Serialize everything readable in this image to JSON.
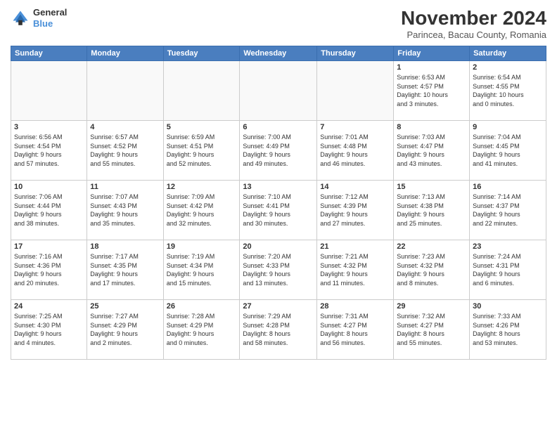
{
  "header": {
    "logo_general": "General",
    "logo_blue": "Blue",
    "month_title": "November 2024",
    "subtitle": "Parincea, Bacau County, Romania"
  },
  "days_of_week": [
    "Sunday",
    "Monday",
    "Tuesday",
    "Wednesday",
    "Thursday",
    "Friday",
    "Saturday"
  ],
  "weeks": [
    [
      {
        "day": "",
        "info": ""
      },
      {
        "day": "",
        "info": ""
      },
      {
        "day": "",
        "info": ""
      },
      {
        "day": "",
        "info": ""
      },
      {
        "day": "",
        "info": ""
      },
      {
        "day": "1",
        "info": "Sunrise: 6:53 AM\nSunset: 4:57 PM\nDaylight: 10 hours\nand 3 minutes."
      },
      {
        "day": "2",
        "info": "Sunrise: 6:54 AM\nSunset: 4:55 PM\nDaylight: 10 hours\nand 0 minutes."
      }
    ],
    [
      {
        "day": "3",
        "info": "Sunrise: 6:56 AM\nSunset: 4:54 PM\nDaylight: 9 hours\nand 57 minutes."
      },
      {
        "day": "4",
        "info": "Sunrise: 6:57 AM\nSunset: 4:52 PM\nDaylight: 9 hours\nand 55 minutes."
      },
      {
        "day": "5",
        "info": "Sunrise: 6:59 AM\nSunset: 4:51 PM\nDaylight: 9 hours\nand 52 minutes."
      },
      {
        "day": "6",
        "info": "Sunrise: 7:00 AM\nSunset: 4:49 PM\nDaylight: 9 hours\nand 49 minutes."
      },
      {
        "day": "7",
        "info": "Sunrise: 7:01 AM\nSunset: 4:48 PM\nDaylight: 9 hours\nand 46 minutes."
      },
      {
        "day": "8",
        "info": "Sunrise: 7:03 AM\nSunset: 4:47 PM\nDaylight: 9 hours\nand 43 minutes."
      },
      {
        "day": "9",
        "info": "Sunrise: 7:04 AM\nSunset: 4:45 PM\nDaylight: 9 hours\nand 41 minutes."
      }
    ],
    [
      {
        "day": "10",
        "info": "Sunrise: 7:06 AM\nSunset: 4:44 PM\nDaylight: 9 hours\nand 38 minutes."
      },
      {
        "day": "11",
        "info": "Sunrise: 7:07 AM\nSunset: 4:43 PM\nDaylight: 9 hours\nand 35 minutes."
      },
      {
        "day": "12",
        "info": "Sunrise: 7:09 AM\nSunset: 4:42 PM\nDaylight: 9 hours\nand 32 minutes."
      },
      {
        "day": "13",
        "info": "Sunrise: 7:10 AM\nSunset: 4:41 PM\nDaylight: 9 hours\nand 30 minutes."
      },
      {
        "day": "14",
        "info": "Sunrise: 7:12 AM\nSunset: 4:39 PM\nDaylight: 9 hours\nand 27 minutes."
      },
      {
        "day": "15",
        "info": "Sunrise: 7:13 AM\nSunset: 4:38 PM\nDaylight: 9 hours\nand 25 minutes."
      },
      {
        "day": "16",
        "info": "Sunrise: 7:14 AM\nSunset: 4:37 PM\nDaylight: 9 hours\nand 22 minutes."
      }
    ],
    [
      {
        "day": "17",
        "info": "Sunrise: 7:16 AM\nSunset: 4:36 PM\nDaylight: 9 hours\nand 20 minutes."
      },
      {
        "day": "18",
        "info": "Sunrise: 7:17 AM\nSunset: 4:35 PM\nDaylight: 9 hours\nand 17 minutes."
      },
      {
        "day": "19",
        "info": "Sunrise: 7:19 AM\nSunset: 4:34 PM\nDaylight: 9 hours\nand 15 minutes."
      },
      {
        "day": "20",
        "info": "Sunrise: 7:20 AM\nSunset: 4:33 PM\nDaylight: 9 hours\nand 13 minutes."
      },
      {
        "day": "21",
        "info": "Sunrise: 7:21 AM\nSunset: 4:32 PM\nDaylight: 9 hours\nand 11 minutes."
      },
      {
        "day": "22",
        "info": "Sunrise: 7:23 AM\nSunset: 4:32 PM\nDaylight: 9 hours\nand 8 minutes."
      },
      {
        "day": "23",
        "info": "Sunrise: 7:24 AM\nSunset: 4:31 PM\nDaylight: 9 hours\nand 6 minutes."
      }
    ],
    [
      {
        "day": "24",
        "info": "Sunrise: 7:25 AM\nSunset: 4:30 PM\nDaylight: 9 hours\nand 4 minutes."
      },
      {
        "day": "25",
        "info": "Sunrise: 7:27 AM\nSunset: 4:29 PM\nDaylight: 9 hours\nand 2 minutes."
      },
      {
        "day": "26",
        "info": "Sunrise: 7:28 AM\nSunset: 4:29 PM\nDaylight: 9 hours\nand 0 minutes."
      },
      {
        "day": "27",
        "info": "Sunrise: 7:29 AM\nSunset: 4:28 PM\nDaylight: 8 hours\nand 58 minutes."
      },
      {
        "day": "28",
        "info": "Sunrise: 7:31 AM\nSunset: 4:27 PM\nDaylight: 8 hours\nand 56 minutes."
      },
      {
        "day": "29",
        "info": "Sunrise: 7:32 AM\nSunset: 4:27 PM\nDaylight: 8 hours\nand 55 minutes."
      },
      {
        "day": "30",
        "info": "Sunrise: 7:33 AM\nSunset: 4:26 PM\nDaylight: 8 hours\nand 53 minutes."
      }
    ]
  ]
}
